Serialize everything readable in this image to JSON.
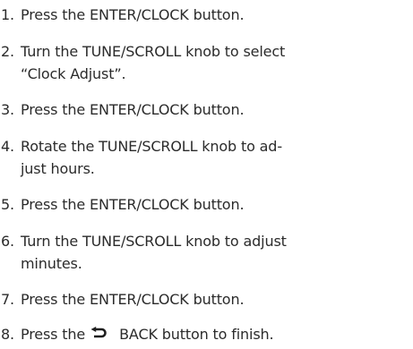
{
  "steps": [
    {
      "number": "1.",
      "lines": [
        "Press the ENTER/CLOCK button."
      ]
    },
    {
      "number": "2.",
      "lines": [
        "Turn the TUNE/SCROLL knob to select",
        "“Clock Adjust”."
      ]
    },
    {
      "number": "3.",
      "lines": [
        "Press the ENTER/CLOCK button."
      ]
    },
    {
      "number": "4.",
      "lines": [
        "Rotate the TUNE/SCROLL knob to ad-",
        "just hours."
      ]
    },
    {
      "number": "5.",
      "lines": [
        "Press the ENTER/CLOCK button."
      ]
    },
    {
      "number": "6.",
      "lines": [
        "Turn the TUNE/SCROLL knob to adjust",
        "minutes."
      ]
    },
    {
      "number": "7.",
      "lines": [
        "Press the ENTER/CLOCK button."
      ]
    },
    {
      "number": "8.",
      "before_icon": "Press the",
      "icon": "back-arrow-icon",
      "after_icon": "BACK button to finish."
    }
  ]
}
